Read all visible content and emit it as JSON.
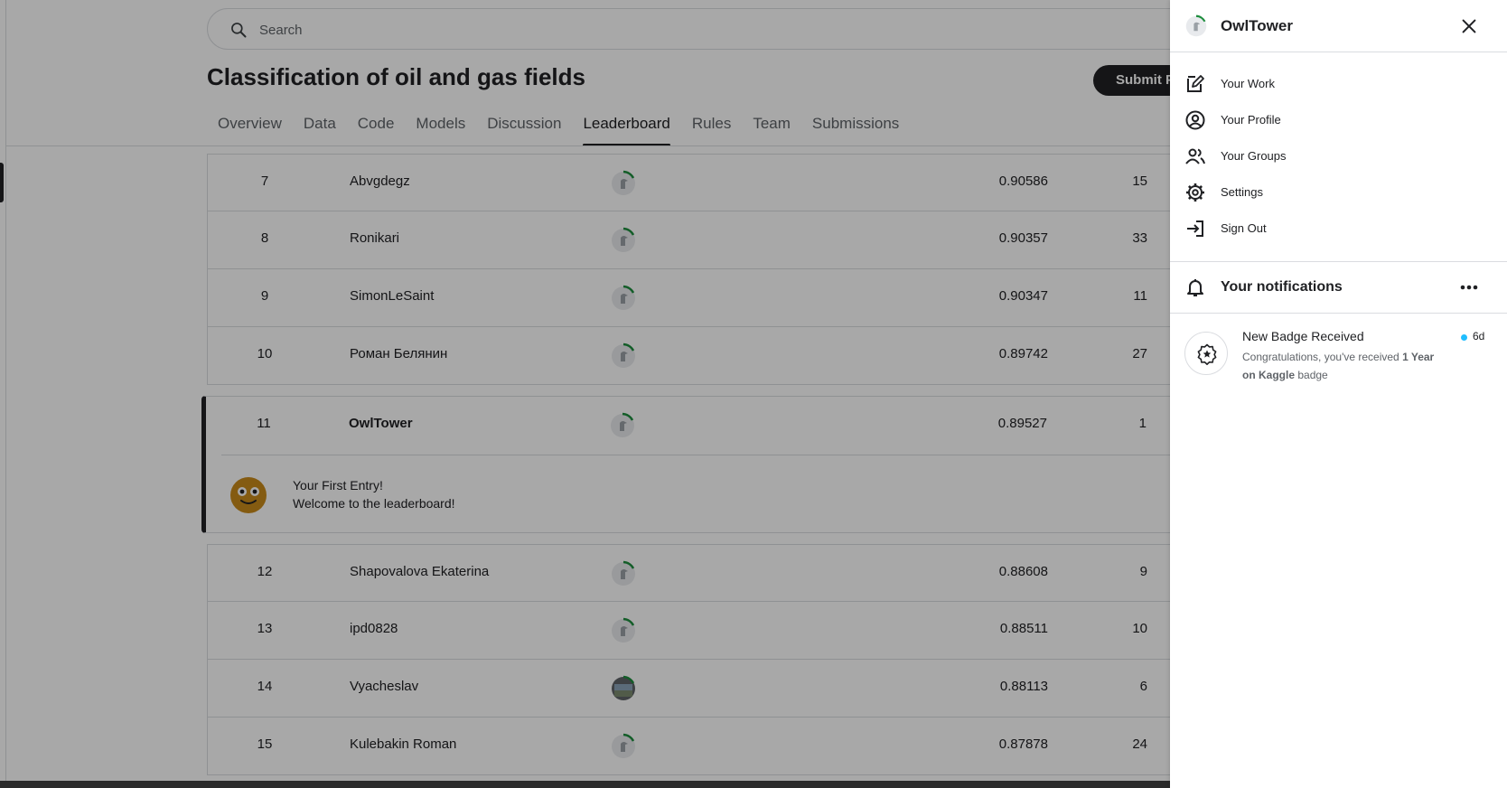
{
  "search": {
    "placeholder": "Search"
  },
  "competition": {
    "title": "Classification of oil and gas fields",
    "submit_label": "Submit Predictions"
  },
  "tabs": [
    {
      "label": "Overview",
      "active": false
    },
    {
      "label": "Data",
      "active": false
    },
    {
      "label": "Code",
      "active": false
    },
    {
      "label": "Models",
      "active": false
    },
    {
      "label": "Discussion",
      "active": false
    },
    {
      "label": "Leaderboard",
      "active": true
    },
    {
      "label": "Rules",
      "active": false
    },
    {
      "label": "Team",
      "active": false
    },
    {
      "label": "Submissions",
      "active": false
    }
  ],
  "leaderboard": {
    "rows_before": [
      {
        "rank": "7",
        "team": "Abvgdegz",
        "score": "0.90586",
        "entries": "15"
      },
      {
        "rank": "8",
        "team": "Ronikari",
        "score": "0.90357",
        "entries": "33"
      },
      {
        "rank": "9",
        "team": "SimonLeSaint",
        "score": "0.90347",
        "entries": "11"
      },
      {
        "rank": "10",
        "team": "Роман Белянин",
        "score": "0.89742",
        "entries": "27"
      }
    ],
    "my_row": {
      "rank": "11",
      "team": "OwlTower",
      "score": "0.89527",
      "entries": "1"
    },
    "first_entry": {
      "line1": "Your First Entry!",
      "line2": "Welcome to the leaderboard!"
    },
    "rows_after": [
      {
        "rank": "12",
        "team": "Shapovalova Ekaterina",
        "score": "0.88608",
        "entries": "9"
      },
      {
        "rank": "13",
        "team": "ipd0828",
        "score": "0.88511",
        "entries": "10"
      },
      {
        "rank": "14",
        "team": "Vyacheslav",
        "score": "0.88113",
        "entries": "6"
      },
      {
        "rank": "15",
        "team": "Kulebakin Roman",
        "score": "0.87878",
        "entries": "24"
      }
    ]
  },
  "panel": {
    "username": "OwlTower",
    "menu": [
      {
        "label": "Your Work",
        "icon": "edit-icon"
      },
      {
        "label": "Your Profile",
        "icon": "profile-icon"
      },
      {
        "label": "Your Groups",
        "icon": "groups-icon"
      },
      {
        "label": "Settings",
        "icon": "settings-icon"
      },
      {
        "label": "Sign Out",
        "icon": "sign-out-icon"
      }
    ],
    "notifications_title": "Your notifications",
    "notification": {
      "title": "New Badge Received",
      "age": "6d",
      "body_prefix": "Congratulations, you've received ",
      "body_bold": "1 Year on Kaggle",
      "body_suffix": " badge"
    }
  },
  "colors": {
    "accent": "#20beff",
    "primary": "#202124",
    "ring": "#1e8e3e"
  }
}
